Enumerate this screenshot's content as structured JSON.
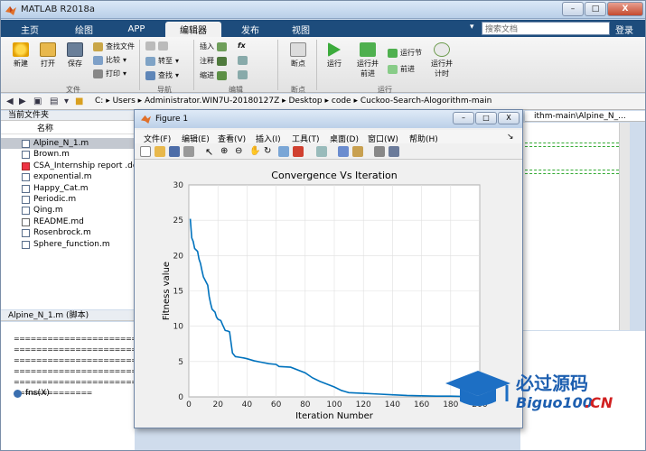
{
  "window": {
    "title": "MATLAB R2018a",
    "minimize": "–",
    "maximize": "□",
    "close": "X"
  },
  "tabs": [
    {
      "label": "主页",
      "active": false
    },
    {
      "label": "绘图",
      "active": false
    },
    {
      "label": "APP",
      "active": false
    },
    {
      "label": "编辑器",
      "active": true
    },
    {
      "label": "发布",
      "active": false
    },
    {
      "label": "视图",
      "active": false
    }
  ],
  "search": {
    "placeholder": "搜索文档",
    "login": "登录"
  },
  "ribbon": {
    "file": {
      "new": "新建",
      "open": "打开",
      "save": "保存",
      "find_file": "查找文件",
      "compare": "比较",
      "print": "打印",
      "group": "文件"
    },
    "navigate": {
      "goto": "转至",
      "find": "查找",
      "group": "导航"
    },
    "edit": {
      "insert": "插入",
      "comment": "注释",
      "indent": "缩进",
      "fx": "fx",
      "group": "编辑"
    },
    "breakpoints": {
      "label": "断点",
      "group": "断点"
    },
    "run": {
      "run": "运行",
      "run_advance": "运行并\n前进",
      "run_section": "运行节",
      "advance": "前进",
      "run_time": "运行并\n计时",
      "group": "运行"
    }
  },
  "address": {
    "path": [
      "C:",
      "Users",
      "Administrator.WIN7U-20180127Z",
      "Desktop",
      "code",
      "Cuckoo-Search-Alogorithm-main"
    ],
    "separator": "▸"
  },
  "current_folder": {
    "title": "当前文件夹",
    "column": "名称",
    "files": [
      {
        "name": "Alpine_N_1.m",
        "type": "m",
        "selected": true
      },
      {
        "name": "Brown.m",
        "type": "m",
        "selected": false
      },
      {
        "name": "CSA_Internship report .docx",
        "type": "doc",
        "selected": false
      },
      {
        "name": "exponential.m",
        "type": "m",
        "selected": false
      },
      {
        "name": "Happy_Cat.m",
        "type": "m",
        "selected": false
      },
      {
        "name": "Periodic.m",
        "type": "m",
        "selected": false
      },
      {
        "name": "Qing.m",
        "type": "m",
        "selected": false
      },
      {
        "name": "README.md",
        "type": "md",
        "selected": false
      },
      {
        "name": "Rosenbrock.m",
        "type": "m",
        "selected": false
      },
      {
        "name": "Sphere_function.m",
        "type": "m",
        "selected": false
      }
    ]
  },
  "details": {
    "title": "Alpine_N_1.m  (脚本)"
  },
  "command_window": {
    "lines": [
      "========================================",
      "========================================",
      "========================================",
      "========================================",
      "========================================",
      "=============="
    ],
    "function_sig": "fns(X)"
  },
  "editor": {
    "tab_label": "ithm-main\\Alpine_N_..."
  },
  "figure": {
    "title": "Figure 1",
    "menu": [
      "文件(F)",
      "编辑(E)",
      "查看(V)",
      "插入(I)",
      "工具(T)",
      "桌面(D)",
      "窗口(W)",
      "帮助(H)"
    ]
  },
  "chart_data": {
    "type": "line",
    "title": "Convergence Vs Iteration",
    "xlabel": "Iteration Number",
    "ylabel": "Fitness value",
    "xlim": [
      0,
      200
    ],
    "ylim": [
      0,
      30
    ],
    "xticks": [
      0,
      20,
      40,
      60,
      80,
      100,
      120,
      140,
      160,
      180,
      200
    ],
    "yticks": [
      0,
      5,
      10,
      15,
      20,
      25,
      30
    ],
    "grid": true,
    "series": [
      {
        "color": "#0072bd",
        "x": [
          1,
          2,
          3,
          4,
          6,
          7,
          8,
          9,
          10,
          12,
          13,
          14,
          15,
          16,
          18,
          19,
          20,
          22,
          23,
          25,
          27,
          28,
          30,
          32,
          35,
          38,
          40,
          45,
          50,
          55,
          60,
          62,
          70,
          80,
          85,
          90,
          95,
          100,
          105,
          110,
          120,
          130,
          140,
          150,
          160,
          170,
          180,
          190,
          200
        ],
        "y": [
          25.2,
          22.5,
          22.0,
          21.0,
          20.6,
          19.5,
          18.9,
          17.9,
          17.0,
          16.2,
          15.8,
          14.2,
          13.2,
          12.4,
          12.0,
          11.3,
          11.0,
          10.8,
          10.3,
          9.4,
          9.3,
          9.2,
          6.2,
          5.7,
          5.6,
          5.5,
          5.4,
          5.1,
          4.9,
          4.7,
          4.6,
          4.3,
          4.2,
          3.4,
          2.7,
          2.2,
          1.8,
          1.4,
          0.9,
          0.6,
          0.5,
          0.4,
          0.3,
          0.2,
          0.15,
          0.1,
          0.1,
          0.05,
          0.0
        ]
      }
    ]
  },
  "watermark": {
    "brand": "必过源码",
    "site": "Biguo100",
    "tld": ".CN"
  }
}
